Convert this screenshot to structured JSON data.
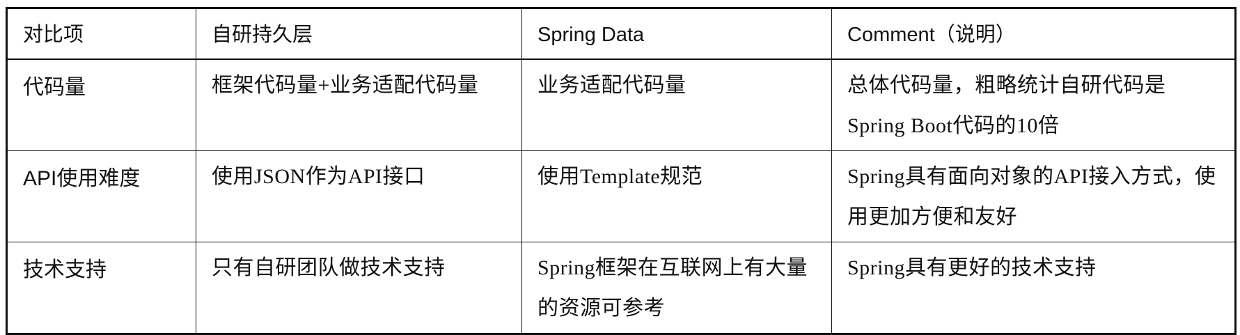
{
  "table": {
    "headers": [
      "对比项",
      "自研持久层",
      "Spring Data",
      "Comment（说明）"
    ],
    "rows": [
      {
        "label": "代码量",
        "self_built": "框架代码量+业务适配代码量",
        "spring_data": "业务适配代码量",
        "comment": "总体代码量，粗略统计自研代码是Spring Boot代码的10倍"
      },
      {
        "label": "API使用难度",
        "self_built": "使用JSON作为API接口",
        "spring_data": "使用Template规范",
        "comment": "Spring具有面向对象的API接入方式，使用更加方便和友好"
      },
      {
        "label": "技术支持",
        "self_built": "只有自研团队做技术支持",
        "spring_data": "Spring框架在互联网上有大量的资源可参考",
        "comment": "Spring具有更好的技术支持"
      }
    ]
  }
}
